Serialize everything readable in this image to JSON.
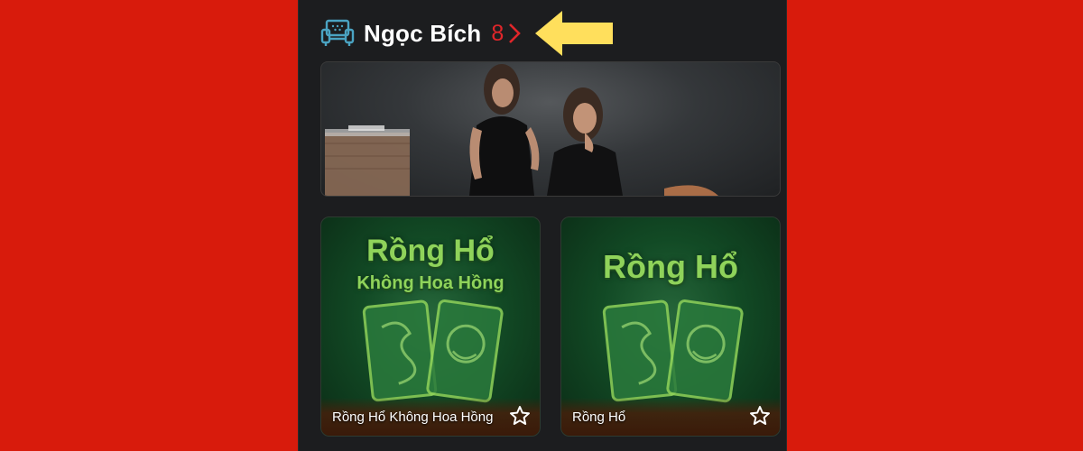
{
  "section": {
    "title": "Ngọc Bích",
    "count": "8",
    "icon": "sofa-icon",
    "more_icon": "chevron-right-icon"
  },
  "pointer": {
    "icon": "arrow-left-icon",
    "color": "#ffdf5c"
  },
  "banner": {
    "alt": "live-dealer-banner"
  },
  "games": [
    {
      "label": "Rồng Hổ Không Hoa Hồng",
      "art_title": "Rồng Hổ",
      "art_subtitle": "Không Hoa Hồng",
      "favorite_icon": "star-icon"
    },
    {
      "label": "Rồng Hổ",
      "art_title": "Rồng Hổ",
      "favorite_icon": "star-icon"
    }
  ],
  "colors": {
    "page_bg": "#d81b0c",
    "panel_bg": "#1c1d1f",
    "count": "#e0262a",
    "card_green": "#26663a",
    "art_text": "#8fd35a"
  }
}
